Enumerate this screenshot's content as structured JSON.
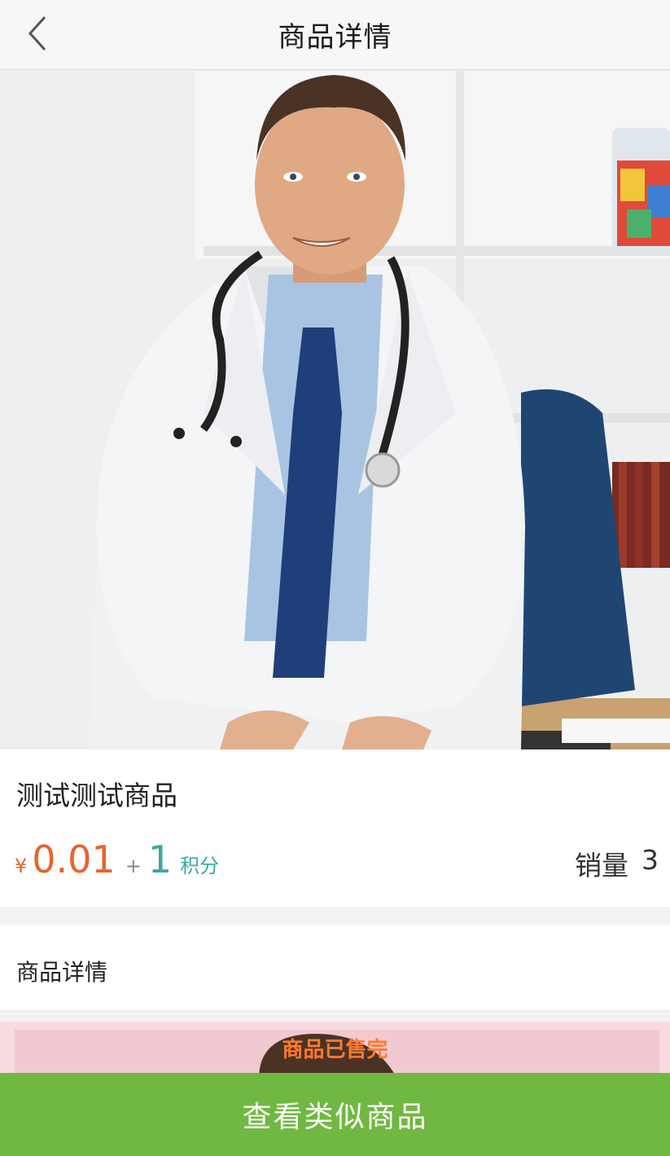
{
  "header": {
    "title": "商品详情"
  },
  "product": {
    "name": "测试测试商品",
    "currency_symbol": "¥",
    "price": "0.01",
    "plus": "+",
    "points": "1",
    "points_unit": "积分",
    "sales_label": "销量",
    "sales_count": "3"
  },
  "details": {
    "title": "商品详情"
  },
  "preview": {
    "sold_out": "商品已售完"
  },
  "actions": {
    "view_similar_label": "查看类似商品"
  },
  "colors": {
    "price": "#e8642c",
    "points": "#3aa9a1",
    "button": "#71b842",
    "sold_out": "#ff7a2f"
  }
}
